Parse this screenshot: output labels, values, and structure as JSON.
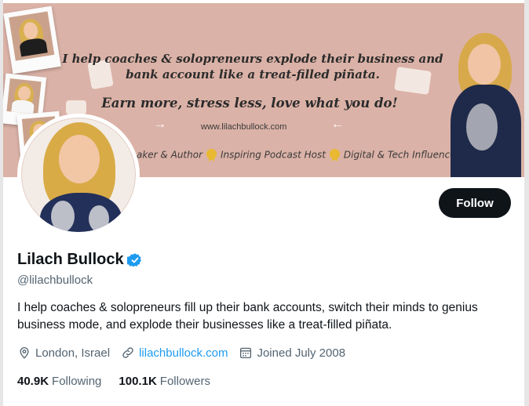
{
  "banner": {
    "headline_1": "I help coaches & solopreneurs explode their business and",
    "headline_2": "bank account like a treat-filled piñata.",
    "slogan": "Earn more, stress less, love what you do!",
    "url": "www.lilachbullock.com",
    "tag_1": "aker & Author",
    "tag_2": "Inspiring Podcast Host",
    "tag_3": "Digital & Tech Influencer",
    "background_color": "#dbb2a7"
  },
  "profile": {
    "display_name": "Lilach Bullock",
    "handle": "@lilachbullock",
    "verified": true,
    "bio": "I help coaches & solopreneurs fill up their bank accounts, switch their minds to genius business mode, and explode their businesses like a treat-filled piñata.",
    "location": "London, Israel",
    "website": "lilachbullock.com",
    "joined": "Joined July 2008"
  },
  "actions": {
    "follow_label": "Follow"
  },
  "stats": {
    "following_count": "40.9K",
    "following_label": "Following",
    "followers_count": "100.1K",
    "followers_label": "Followers"
  },
  "icons": {
    "location": "location-pin-icon",
    "link": "link-icon",
    "calendar": "calendar-icon",
    "verified": "verified-badge-icon"
  },
  "colors": {
    "accent": "#1d9bf0",
    "text_primary": "#0f1419",
    "text_secondary": "#536471",
    "button_bg": "#0f1419"
  }
}
